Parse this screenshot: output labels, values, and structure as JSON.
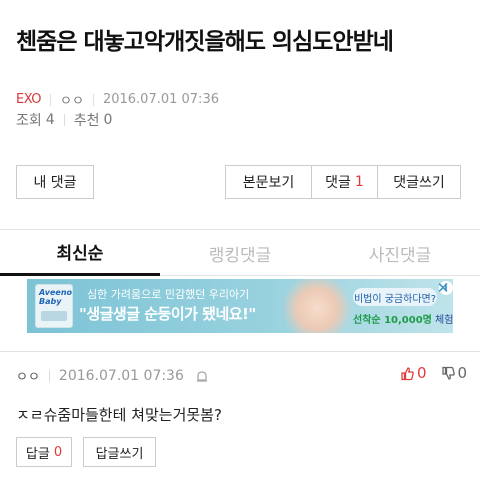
{
  "post": {
    "title": "첸줌은 대놓고악개짓을해도 의심도안받네",
    "category": "EXO",
    "author": "ㅇㅇ",
    "datetime": "2016.07.01 07:36",
    "views_label": "조회",
    "views": "4",
    "likes_label": "추천",
    "likes": "0"
  },
  "actions": {
    "my_comments": "내 댓글",
    "view_post": "본문보기",
    "comments_label": "댓글",
    "comments_count": "1",
    "write_comment": "댓글쓰기"
  },
  "tabs": [
    {
      "label": "최신순",
      "active": true
    },
    {
      "label": "랭킹댓글",
      "active": false
    },
    {
      "label": "사진댓글",
      "active": false
    }
  ],
  "ad": {
    "brand": "Aveeno Baby",
    "line1": "심한 가려움으로 민감했던 우리아기",
    "line2": "\"생글생글 순둥이가 됐네요!\"",
    "pill": "비법이 궁금하다면?",
    "sub_prefix": "선착순 10,000명",
    "sub_suffix": " 체험키트",
    "info_icon": "i",
    "close_icon": "✕"
  },
  "comment": {
    "author": "ㅇㅇ",
    "datetime": "2016.07.01 07:36",
    "upvotes": "0",
    "downvotes": "0",
    "text": "ㅈㄹ슈줌마들한테 쳐맞는거못봄?",
    "reply_label": "답글",
    "reply_count": "0",
    "write_reply": "답글쓰기"
  },
  "colors": {
    "accent_red": "#e23a3a",
    "category_red": "#d93a3a",
    "ad_bg": "#7cc3d6"
  }
}
